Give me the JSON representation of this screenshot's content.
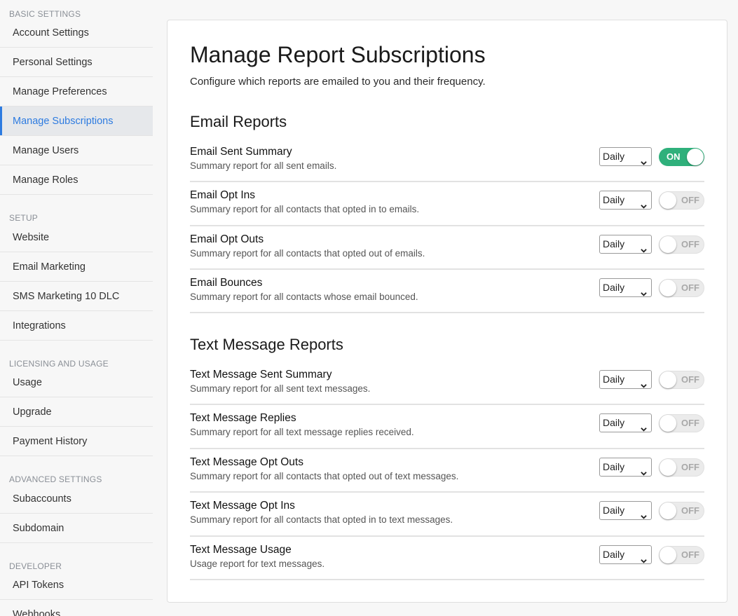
{
  "sidebar": {
    "sections": [
      {
        "heading": "BASIC SETTINGS",
        "items": [
          "Account Settings",
          "Personal Settings",
          "Manage Preferences",
          "Manage Subscriptions",
          "Manage Users",
          "Manage Roles"
        ]
      },
      {
        "heading": "SETUP",
        "items": [
          "Website",
          "Email Marketing",
          "SMS Marketing 10 DLC",
          "Integrations"
        ]
      },
      {
        "heading": "LICENSING AND USAGE",
        "items": [
          "Usage",
          "Upgrade",
          "Payment History"
        ]
      },
      {
        "heading": "ADVANCED SETTINGS",
        "items": [
          "Subaccounts",
          "Subdomain"
        ]
      },
      {
        "heading": "DEVELOPER",
        "items": [
          "API Tokens",
          "Webhooks"
        ]
      }
    ],
    "active_item": "Manage Subscriptions"
  },
  "page": {
    "title": "Manage Report Subscriptions",
    "subtitle": "Configure which reports are emailed to you and their frequency."
  },
  "colors": {
    "accent": "#2d7be0",
    "toggle_on": "#2fb07b"
  },
  "groups": [
    {
      "title": "Email Reports",
      "reports": [
        {
          "name": "Email Sent Summary",
          "desc": "Summary report for all sent emails.",
          "frequency": "Daily",
          "enabled": true,
          "toggle_label": "ON"
        },
        {
          "name": "Email Opt Ins",
          "desc": "Summary report for all contacts that opted in to emails.",
          "frequency": "Daily",
          "enabled": false,
          "toggle_label": "OFF"
        },
        {
          "name": "Email Opt Outs",
          "desc": "Summary report for all contacts that opted out of emails.",
          "frequency": "Daily",
          "enabled": false,
          "toggle_label": "OFF"
        },
        {
          "name": "Email Bounces",
          "desc": "Summary report for all contacts whose email bounced.",
          "frequency": "Daily",
          "enabled": false,
          "toggle_label": "OFF"
        }
      ]
    },
    {
      "title": "Text Message Reports",
      "reports": [
        {
          "name": "Text Message Sent Summary",
          "desc": "Summary report for all sent text messages.",
          "frequency": "Daily",
          "enabled": false,
          "toggle_label": "OFF"
        },
        {
          "name": "Text Message Replies",
          "desc": "Summary report for all text message replies received.",
          "frequency": "Daily",
          "enabled": false,
          "toggle_label": "OFF"
        },
        {
          "name": "Text Message Opt Outs",
          "desc": "Summary report for all contacts that opted out of text messages.",
          "frequency": "Daily",
          "enabled": false,
          "toggle_label": "OFF"
        },
        {
          "name": "Text Message Opt Ins",
          "desc": "Summary report for all contacts that opted in to text messages.",
          "frequency": "Daily",
          "enabled": false,
          "toggle_label": "OFF"
        },
        {
          "name": "Text Message Usage",
          "desc": "Usage report for text messages.",
          "frequency": "Daily",
          "enabled": false,
          "toggle_label": "OFF"
        }
      ]
    }
  ]
}
